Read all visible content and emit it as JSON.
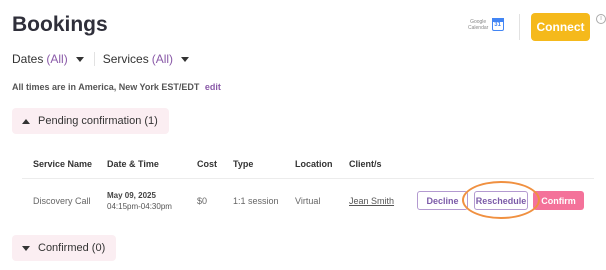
{
  "header": {
    "title": "Bookings",
    "google_calendar": {
      "line1": "Google",
      "line2": "Calendar",
      "icon_text": "31"
    },
    "connect_label": "Connect",
    "info_glyph": "i"
  },
  "filters": [
    {
      "label": "Dates",
      "value": "(All)"
    },
    {
      "label": "Services",
      "value": "(All)"
    }
  ],
  "timezone": {
    "text": "All times are in America, New York EST/EDT",
    "edit_label": "edit"
  },
  "pending_section": {
    "label": "Pending confirmation (1)",
    "expanded": true
  },
  "table": {
    "headers": [
      "Service Name",
      "Date & Time",
      "Cost",
      "Type",
      "Location",
      "Client/s"
    ],
    "rows": [
      {
        "service": "Discovery Call",
        "date": "May 09, 2025",
        "time": "04:15pm-04:30pm",
        "cost": "$0",
        "type": "1:1 session",
        "location": "Virtual",
        "client": "Jean Smith",
        "actions": {
          "decline": "Decline",
          "reschedule": "Reschedule",
          "confirm": "Confirm"
        }
      }
    ]
  },
  "confirmed_section": {
    "label": "Confirmed (0)",
    "expanded": false
  },
  "colors": {
    "accent_yellow": "#f5b91b",
    "accent_pink": "#f4729a",
    "section_bg": "#fbeef2",
    "purple": "#7b5aa8",
    "highlight": "#f09040"
  }
}
